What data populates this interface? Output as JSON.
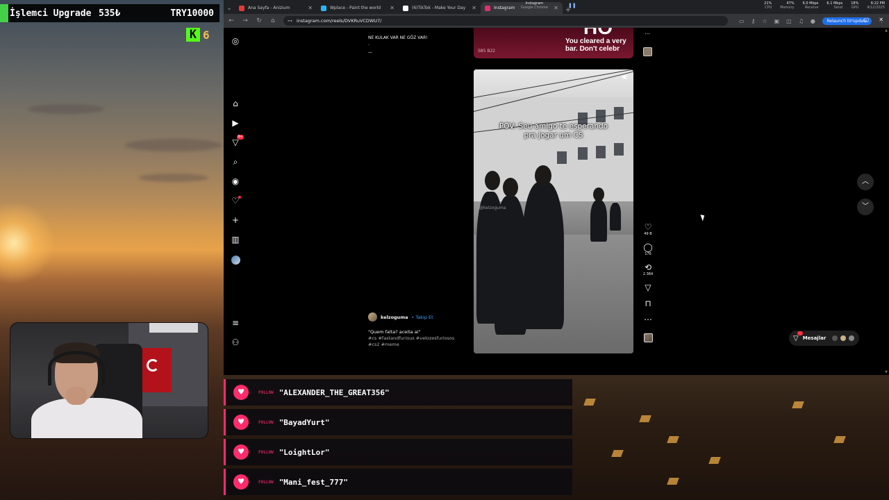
{
  "hud": {
    "title": "İşlemci Upgrade",
    "value": "535₺",
    "goal": "TRY10000",
    "kick_logo": "K",
    "kick_count": "6"
  },
  "browser": {
    "tabs": [
      {
        "label": "Ana Sayfa - Anizium",
        "color": "#e53935",
        "active": false
      },
      {
        "label": "Wplace - Paint the world",
        "color": "#29b6f6",
        "active": false
      },
      {
        "label": "(6)TikTok - Make Your Day",
        "color": "#ffffff",
        "active": false
      },
      {
        "label": "Instagram",
        "color": "#e1306c",
        "active": true
      }
    ],
    "media": {
      "title": "Instagram",
      "subtitle": "Google Chrome"
    },
    "sys": [
      {
        "value": "21%",
        "label": "CPU"
      },
      {
        "value": "47%",
        "label": "Memory"
      },
      {
        "value": "6.0 Mbps",
        "label": "Receive"
      },
      {
        "value": "6.1 Mbps",
        "label": "Send"
      },
      {
        "value": "18%",
        "label": "GPU"
      },
      {
        "value": "6:22 PM",
        "label": "4/12/2025"
      }
    ],
    "url": "instagram.com/reels/DVKRuVCDWU7/",
    "relaunch": "Relaunch to update"
  },
  "instagram": {
    "sidebar_badge": "9+",
    "prev_caption": [
      "NE KULAK VAR NE GÖZ VAR!",
      ".",
      "__"
    ],
    "prev_reel_text": [
      "You cleared a very",
      "bar. Don't celebr"
    ],
    "prev_reel_big": "HO",
    "prev_reel_tag": "S85 B22",
    "reel_caption": [
      "POV: Seu amigo te esperando",
      "pra jogar um CS"
    ],
    "reel_watermark": "@kelzoguma",
    "author": "kelzoguma",
    "follow": "• Takip Et",
    "description": "\"Quem falta? aceita ai\"",
    "tags": "#cs #fastandfurious #velozesfuriosos #cs2 #meme",
    "likes": "49 B",
    "comments": "176",
    "shares": "2.384",
    "messages_label": "Mesajlar"
  },
  "alerts": [
    {
      "tag": "FOLLOW",
      "name": "\"ALEXANDER_THE_GREAT356\""
    },
    {
      "tag": "FOLLOW",
      "name": "\"BayadYurt\""
    },
    {
      "tag": "FOLLOW",
      "name": "\"LoightLor\""
    },
    {
      "tag": "FOLLOW",
      "name": "\"Mani_fest_777\""
    }
  ],
  "colors": {
    "accent": "#ff2b6b",
    "kick": "#53fc18",
    "chrome_blue": "#1f6feb",
    "ig_red": "#ff3040"
  }
}
